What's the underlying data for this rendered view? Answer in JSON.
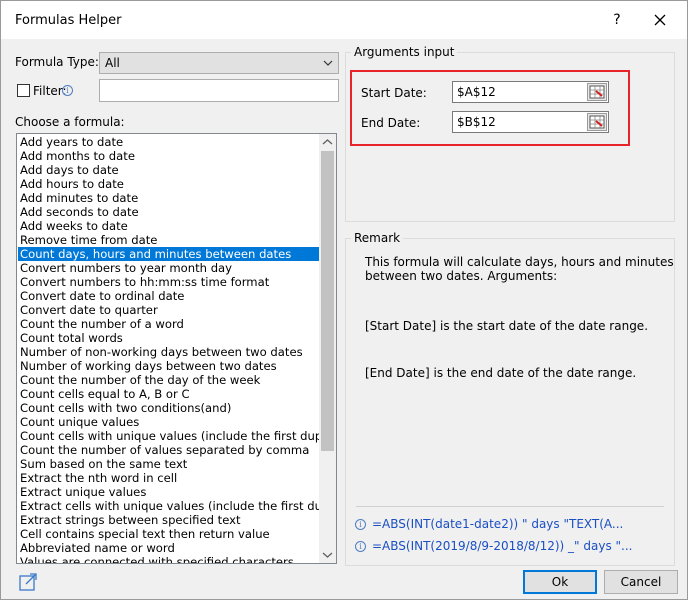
{
  "window": {
    "title": "Formulas Helper",
    "help": "?"
  },
  "formula_type": {
    "label": "Formula Type:",
    "value": "All"
  },
  "filter": {
    "label": "Filter:",
    "value": ""
  },
  "choose_label": "Choose a formula:",
  "formulas": [
    "Add years to date",
    "Add months to date",
    "Add days to date",
    "Add hours to date",
    "Add minutes to date",
    "Add seconds to date",
    "Add weeks to date",
    "Remove time from date",
    "Count days, hours and minutes between dates",
    "Convert numbers to year month day",
    "Convert numbers to hh:mm:ss time format",
    "Convert date to ordinal date",
    "Convert date to quarter",
    "Count the number of a word",
    "Count total words",
    "Number of non-working days between two dates",
    "Number of working days between two dates",
    "Count the number of the day of the week",
    "Count cells equal to A, B or C",
    "Count cells with two conditions(and)",
    "Count unique values",
    "Count cells with unique values (include the first duplica",
    "Count the number of values separated by comma",
    "Sum based on the same text",
    "Extract the nth word in cell",
    "Extract unique values",
    "Extract cells with unique values (include the first duplic",
    "Extract strings between specified text",
    "Cell contains special text then return value",
    "Abbreviated name or word",
    "Values are connected with specified characters"
  ],
  "selected_formula_index": 8,
  "arguments": {
    "title": "Arguments input",
    "start_label": "Start Date:",
    "start_value": "$A$12",
    "end_label": "End Date:",
    "end_value": "$B$12"
  },
  "remark": {
    "title": "Remark",
    "line1": "This formula will calculate days, hours and minutes",
    "line2": "between two dates. Arguments:",
    "start_desc": "[Start Date] is the start date of the date range.",
    "end_desc": "[End Date] is the end date of the date range.",
    "example1": "=ABS(INT(date1-date2)) \" days \"TEXT(A...",
    "example2": "=ABS(INT(2019/8/9-2018/8/12)) _\" days \"..."
  },
  "buttons": {
    "ok": "Ok",
    "cancel": "Cancel"
  },
  "colors": {
    "selection": "#0078d7",
    "highlight": "#e8242b",
    "link": "#1a4fc4"
  }
}
